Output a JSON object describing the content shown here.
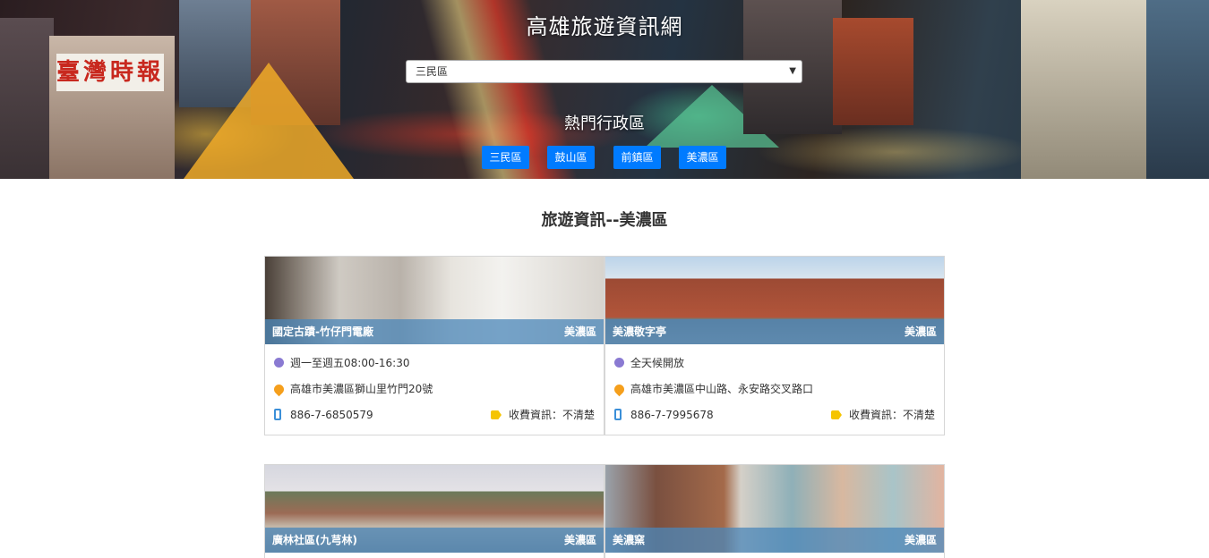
{
  "header": {
    "title": "高雄旅遊資訊網",
    "select_value": "三民區",
    "popular_label": "熱門行政區",
    "popular_districts": [
      "三民區",
      "鼓山區",
      "前鎮區",
      "美濃區"
    ]
  },
  "section": {
    "title": "旅遊資訊--美濃區"
  },
  "cards": [
    {
      "name": "國定古蹟-竹仔門電廠",
      "district": "美濃區",
      "hours": "週一至週五08:00-16:30",
      "address": "高雄市美濃區獅山里竹門20號",
      "phone": "886-7-6850579",
      "fee": "收費資訊：不清楚"
    },
    {
      "name": "美濃敬字亭",
      "district": "美濃區",
      "hours": "全天候開放",
      "address": "高雄市美濃區中山路、永安路交叉路口",
      "phone": "886-7-7995678",
      "fee": "收費資訊：不清楚"
    },
    {
      "name": "廣林社區(九芎林)",
      "district": "美濃區"
    },
    {
      "name": "美濃窯",
      "district": "美濃區"
    }
  ],
  "colors": {
    "primary_button": "#007bff",
    "card_bar": "#4b87b9",
    "clock_icon": "#8a7ad2",
    "pin_icon": "#f59f1c",
    "phone_icon": "#3b8fd8",
    "tag_icon": "#f5c400"
  },
  "icons": [
    "clock-icon",
    "map-pin-icon",
    "phone-icon",
    "tag-icon",
    "chevron-down-icon"
  ]
}
